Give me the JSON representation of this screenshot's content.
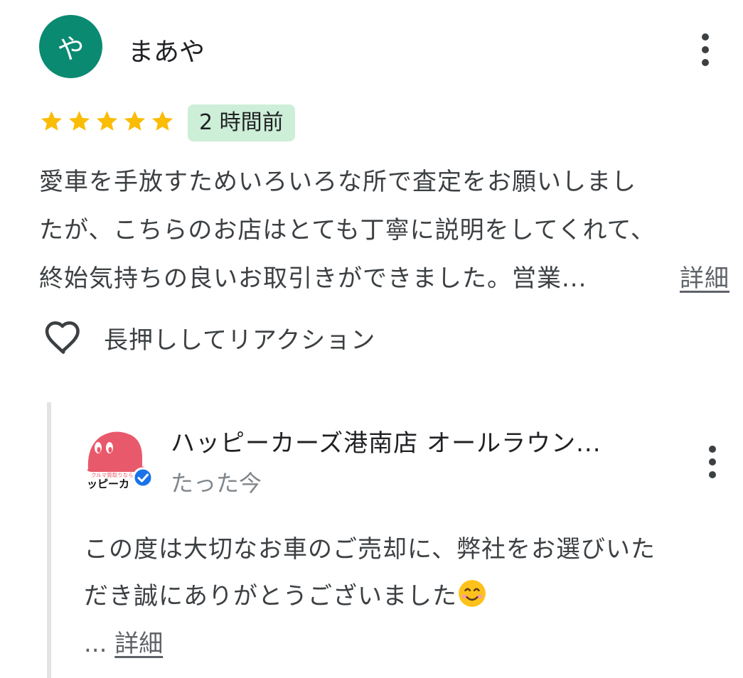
{
  "review": {
    "avatar_initial": "や",
    "author": "まあや",
    "rating": 5,
    "time": "2 時間前",
    "text_lines": [
      "愛車を手放すためいろいろな所で査定をお願いしまし",
      "たが、こちらのお店はとても丁寧に説明をしてくれて、",
      "終始気持ちの良いお取引きができました。営業..."
    ],
    "more_label": "詳細",
    "reaction_label": "長押ししてリアクション"
  },
  "reply": {
    "owner_name": "ハッピーカーズ港南店 オールラウン...",
    "time": "たった今",
    "text_lines": [
      "この度は大切なお車のご売却に、弊社をお選びいた",
      "だき誠にありがとうございました"
    ],
    "ellipsis": "...",
    "more_label": "詳細",
    "logo_text_top": "クルマ買取りならハ",
    "logo_text_bottom": "ッピーカ"
  },
  "colors": {
    "avatar_bg": "#0b8a72",
    "star": "#fbbc04",
    "badge_bg": "#cdeed7",
    "verified": "#1a73e8",
    "logo_pink": "#e8596b"
  },
  "icons": [
    "more-vert-icon",
    "star-icon",
    "heart-outline-icon",
    "verified-icon",
    "smile-emoji-icon"
  ]
}
